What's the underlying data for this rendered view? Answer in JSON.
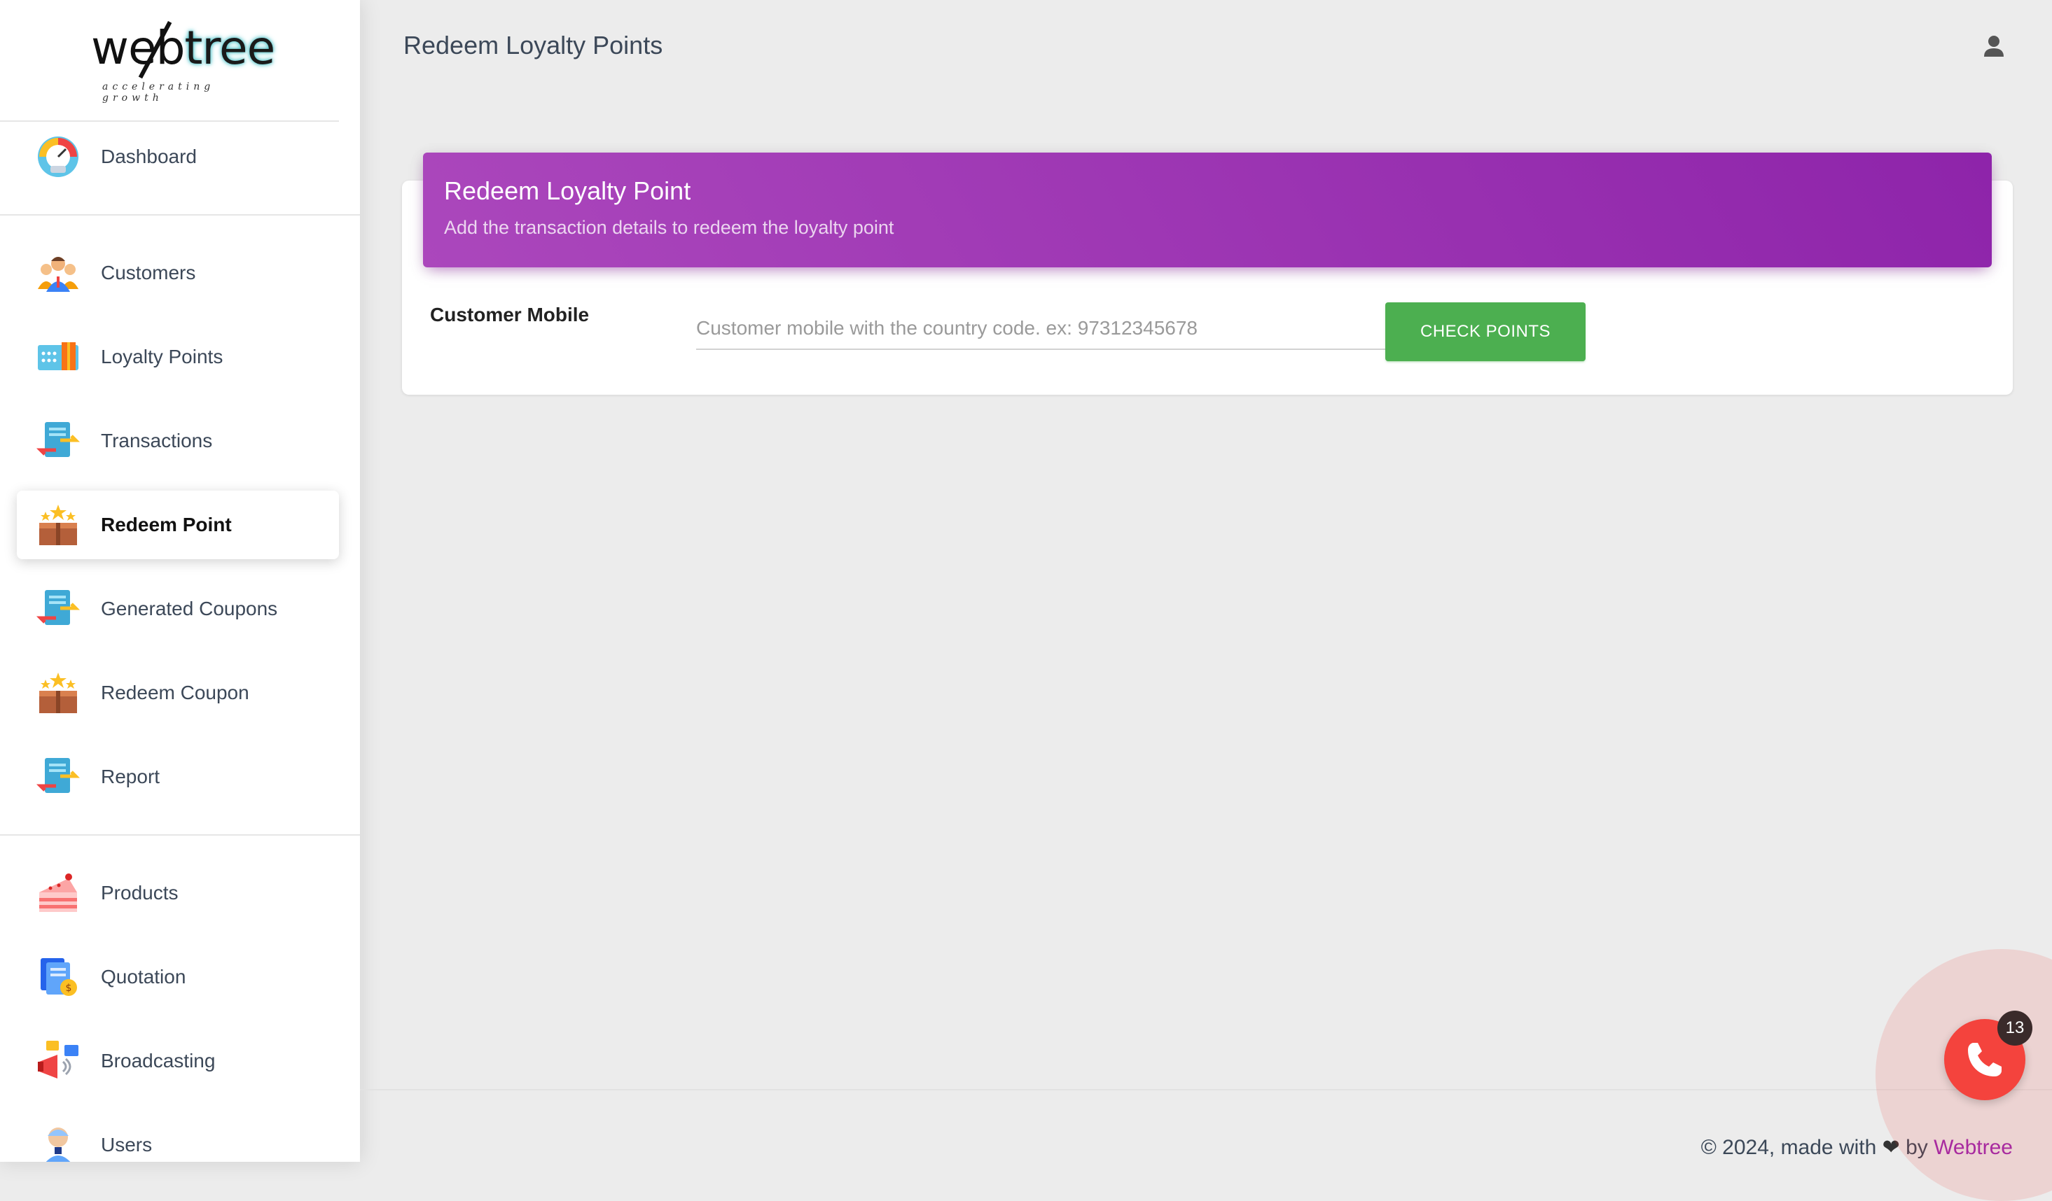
{
  "logo": {
    "word": "web",
    "word2": "tree",
    "tagline": "accelerating growth"
  },
  "header": {
    "title": "Redeem Loyalty Points"
  },
  "sidebar": {
    "items": [
      {
        "label": "Dashboard",
        "icon": "dashboard-gauge-icon"
      },
      {
        "label": "Customers",
        "icon": "customers-icon"
      },
      {
        "label": "Loyalty Points",
        "icon": "loyalty-points-icon"
      },
      {
        "label": "Transactions",
        "icon": "transactions-icon"
      },
      {
        "label": "Redeem Point",
        "icon": "redeem-box-icon",
        "active": true
      },
      {
        "label": "Generated Coupons",
        "icon": "coupons-icon"
      },
      {
        "label": "Redeem Coupon",
        "icon": "redeem-box-icon"
      },
      {
        "label": "Report",
        "icon": "report-icon"
      },
      {
        "label": "Products",
        "icon": "cake-icon"
      },
      {
        "label": "Quotation",
        "icon": "quotation-icon"
      },
      {
        "label": "Broadcasting",
        "icon": "megaphone-icon"
      },
      {
        "label": "Users",
        "icon": "user-avatar-icon"
      }
    ]
  },
  "card": {
    "title": "Redeem Loyalty Point",
    "subtitle": "Add the transaction details to redeem the loyalty point",
    "field_label": "Customer Mobile",
    "input_placeholder": "Customer mobile with the country code. ex: 97312345678",
    "input_value": "",
    "button_label": "CHECK POINTS"
  },
  "footer": {
    "prefix": "© 2024, made with",
    "by": "by",
    "brand": "Webtree"
  },
  "call_widget": {
    "badge_count": "13"
  },
  "colors": {
    "accent": "#9c27b0",
    "button": "#4caf50",
    "call": "#f4433d"
  }
}
